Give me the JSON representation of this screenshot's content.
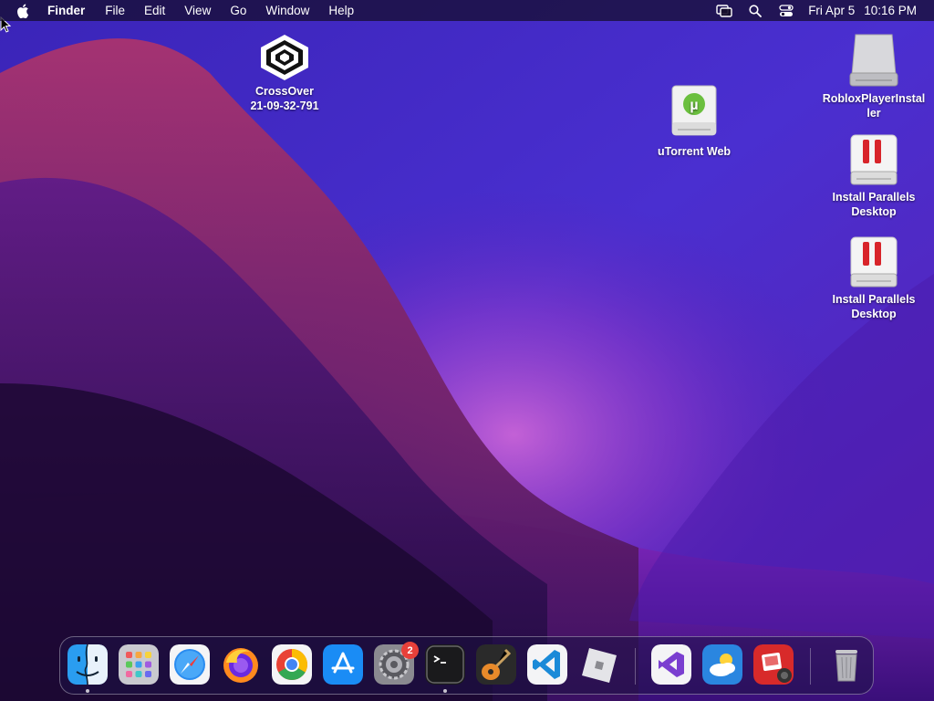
{
  "menubar": {
    "app_name": "Finder",
    "menus": [
      "File",
      "Edit",
      "View",
      "Go",
      "Window",
      "Help"
    ],
    "clock_day": "Fri Apr 5",
    "clock_time": "10:16 PM"
  },
  "desktop": {
    "icons": [
      {
        "name": "crossover",
        "label_line1": "CrossOver",
        "label_line2": "21-09-32-791",
        "icon": "crossover-icon"
      },
      {
        "name": "utorrent",
        "label_line1": "uTorrent Web",
        "label_line2": "",
        "icon": "utorrent-disk-icon"
      },
      {
        "name": "roblox",
        "label_line1": "RobloxPlayerInstal",
        "label_line2": "ler",
        "icon": "disk-image-icon"
      },
      {
        "name": "parallels-1",
        "label_line1": "Install Parallels",
        "label_line2": "Desktop",
        "icon": "parallels-disk-icon"
      },
      {
        "name": "parallels-2",
        "label_line1": "Install Parallels",
        "label_line2": "Desktop",
        "icon": "parallels-disk-icon"
      }
    ]
  },
  "dock": {
    "apps": [
      "Finder",
      "Launchpad",
      "Safari",
      "Firefox",
      "Google Chrome",
      "App Store",
      "System Preferences",
      "Terminal",
      "GarageBand",
      "Visual Studio Code",
      "Roblox",
      "Visual Studio",
      "Weather",
      "Photo Booth",
      "Trash"
    ],
    "system_preferences_badge": "2"
  },
  "colors": {
    "accent_purple": "#7a2cc9",
    "badge_red": "#e8403a"
  }
}
